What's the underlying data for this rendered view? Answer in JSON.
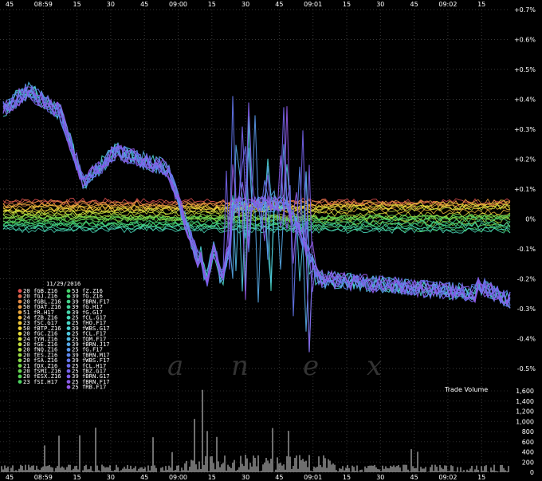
{
  "chart_data": {
    "type": "line",
    "date": "11/29/2016",
    "watermark": [
      "a",
      "n",
      "e",
      "x"
    ],
    "x_ticks": [
      "45",
      "08:59",
      "15",
      "30",
      "45",
      "09:00",
      "15",
      "30",
      "45",
      "09:01",
      "15",
      "30",
      "45",
      "09:02",
      "15"
    ],
    "y_ticks": [
      "+0.7%",
      "+0.6%",
      "+0.5%",
      "+0.4%",
      "+0.3%",
      "+0.2%",
      "+0.1%",
      "0%",
      "-0.1%",
      "-0.2%",
      "-0.3%",
      "-0.4%",
      "-0.5%"
    ],
    "ylim": [
      -0.5,
      0.7
    ],
    "volume_label": "Trade Volume",
    "volume_ticks": [
      "1,600",
      "1,400",
      "1,200",
      "1,000",
      "800",
      "600",
      "400",
      "200",
      "0"
    ],
    "volume_ylim": [
      0,
      1600
    ],
    "legend_left": [
      {
        "n": "20",
        "sym": "fGB.Z16",
        "color": "#e05050"
      },
      {
        "n": "20",
        "sym": "fGJ.Z16",
        "color": "#e06a4a"
      },
      {
        "n": "20",
        "sym": "fGBL.Z16",
        "color": "#e58a45"
      },
      {
        "n": "50",
        "sym": "fOAT.Z16",
        "color": "#e89a40"
      },
      {
        "n": "51",
        "sym": "fR.H17",
        "color": "#eba63c"
      },
      {
        "n": "24",
        "sym": "fZB.Z16",
        "color": "#efb83a"
      },
      {
        "n": "23",
        "sym": "fSC.G17",
        "color": "#f0c83a"
      },
      {
        "n": "50",
        "sym": "fBTP.Z16",
        "color": "#efd23a"
      },
      {
        "n": "20",
        "sym": "fGC.Z16",
        "color": "#e6dc3a"
      },
      {
        "n": "24",
        "sym": "fYM.Z16",
        "color": "#d6e03c"
      },
      {
        "n": "20",
        "sym": "fGE.Z16",
        "color": "#c4e03e"
      },
      {
        "n": "20",
        "sym": "fNQ.Z16",
        "color": "#b0de40"
      },
      {
        "n": "20",
        "sym": "fES.Z16",
        "color": "#9cdc44"
      },
      {
        "n": "20",
        "sym": "fSA.Z16",
        "color": "#88da48"
      },
      {
        "n": "21",
        "sym": "fDX.Z16",
        "color": "#76d84c"
      },
      {
        "n": "20",
        "sym": "fSMI.Z16",
        "color": "#66d650"
      },
      {
        "n": "20",
        "sym": "fESX.Z16",
        "color": "#56d456"
      },
      {
        "n": "23",
        "sym": "fSI.H17",
        "color": "#4cd260"
      }
    ],
    "legend_right": [
      {
        "n": "53",
        "sym": "fZ.Z16",
        "color": "#46d26c"
      },
      {
        "n": "39",
        "sym": "fG.Z16",
        "color": "#44d27a"
      },
      {
        "n": "39",
        "sym": "fBRN.F17",
        "color": "#44d28a"
      },
      {
        "n": "39",
        "sym": "fG.H17",
        "color": "#44d29a"
      },
      {
        "n": "39",
        "sym": "fG.G17",
        "color": "#46d4aa"
      },
      {
        "n": "25",
        "sym": "fCL.G17",
        "color": "#48d6b8"
      },
      {
        "n": "25",
        "sym": "fHO.F17",
        "color": "#4ad6c6"
      },
      {
        "n": "39",
        "sym": "fWBS.G17",
        "color": "#4cd2d2"
      },
      {
        "n": "25",
        "sym": "fCL.F17",
        "color": "#4ec6dc"
      },
      {
        "n": "25",
        "sym": "fQM.F17",
        "color": "#52b8e2"
      },
      {
        "n": "39",
        "sym": "fBRN.J17",
        "color": "#56a8e6"
      },
      {
        "n": "25",
        "sym": "fG.F17",
        "color": "#5a98ea"
      },
      {
        "n": "39",
        "sym": "fBRN.M17",
        "color": "#5e88ee"
      },
      {
        "n": "39",
        "sym": "fWBS.F17",
        "color": "#6478ee"
      },
      {
        "n": "25",
        "sym": "fCL.H17",
        "color": "#6c6cee"
      },
      {
        "n": "25",
        "sym": "fBZ.G17",
        "color": "#7664ec"
      },
      {
        "n": "39",
        "sym": "fBRN.G17",
        "color": "#8060ea"
      },
      {
        "n": "25",
        "sym": "fBRN.F17",
        "color": "#8a5ce8"
      },
      {
        "n": "25",
        "sym": "fRB.F17",
        "color": "#945ae6"
      }
    ]
  }
}
